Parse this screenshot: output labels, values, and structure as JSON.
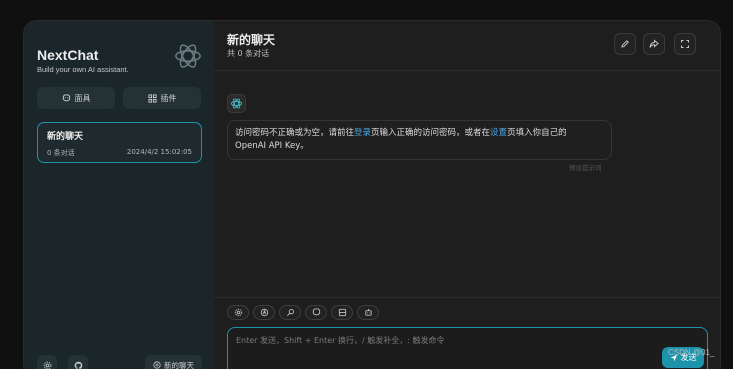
{
  "sidebar": {
    "title": "NextChat",
    "subtitle": "Build your own AI assistant.",
    "mask_label": "面具",
    "plugin_label": "插件",
    "chats": [
      {
        "title": "新的聊天",
        "count": "0 条对话",
        "time": "2024/4/2 15:02:05"
      }
    ],
    "new_chat_label": "新的聊天"
  },
  "header": {
    "title": "新的聊天",
    "subtitle": "共 0 条对话"
  },
  "message": {
    "part1": "访问密码不正确或为空，请前往",
    "link1": "登录",
    "part2": "页输入正确的访问密码，或者在",
    "link2": "设置",
    "part3": "页填入你自己的",
    "line2": "OpenAI API Key。",
    "meta": "预设提示词"
  },
  "input": {
    "placeholder": "Enter 发送，Shift + Enter 换行，/ 触发补全，: 触发命令",
    "send_label": "发送"
  },
  "watermark": "CSDN @01_",
  "colors": {
    "accent": "#1d93ab",
    "sidebar_bg": "#1b262a",
    "main_bg": "#1e1e1e",
    "link": "#4aa3df"
  }
}
